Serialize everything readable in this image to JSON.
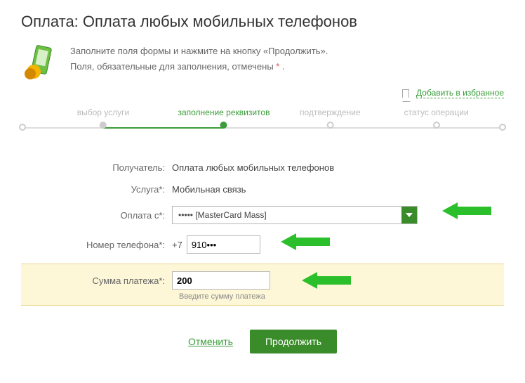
{
  "page_title": "Оплата: Оплата любых мобильных телефонов",
  "intro": {
    "line1": "Заполните поля формы и нажмите на кнопку «Продолжить».",
    "line2_prefix": "Поля, обязательные для заполнения, отмечены ",
    "line2_star": "*",
    "line2_suffix": " ."
  },
  "favorites_label": "Добавить в избранное",
  "stepper": {
    "steps": [
      {
        "label": "выбор услуги",
        "state": "done"
      },
      {
        "label": "заполнение реквизитов",
        "state": "active"
      },
      {
        "label": "подтверждение",
        "state": "future"
      },
      {
        "label": "статус операции",
        "state": "future"
      }
    ]
  },
  "form": {
    "recipient": {
      "label": "Получатель:",
      "value": "Оплата любых мобильных телефонов"
    },
    "service": {
      "label": "Услуга*:",
      "value": "Мобильная связь"
    },
    "pay_from": {
      "label": "Оплата с*:",
      "selected": "•••••      [MasterCard Mass]"
    },
    "phone": {
      "label": "Номер телефона*:",
      "prefix": "+7",
      "value": "910•••"
    },
    "amount": {
      "label": "Сумма платежа*:",
      "value": "200",
      "hint": "Введите сумму платежа"
    }
  },
  "actions": {
    "cancel": "Отменить",
    "continue": "Продолжить"
  },
  "colors": {
    "accent": "#3a9c3a",
    "accent_dark": "#3a8c2a",
    "highlight_bg": "#fdf7d8"
  }
}
